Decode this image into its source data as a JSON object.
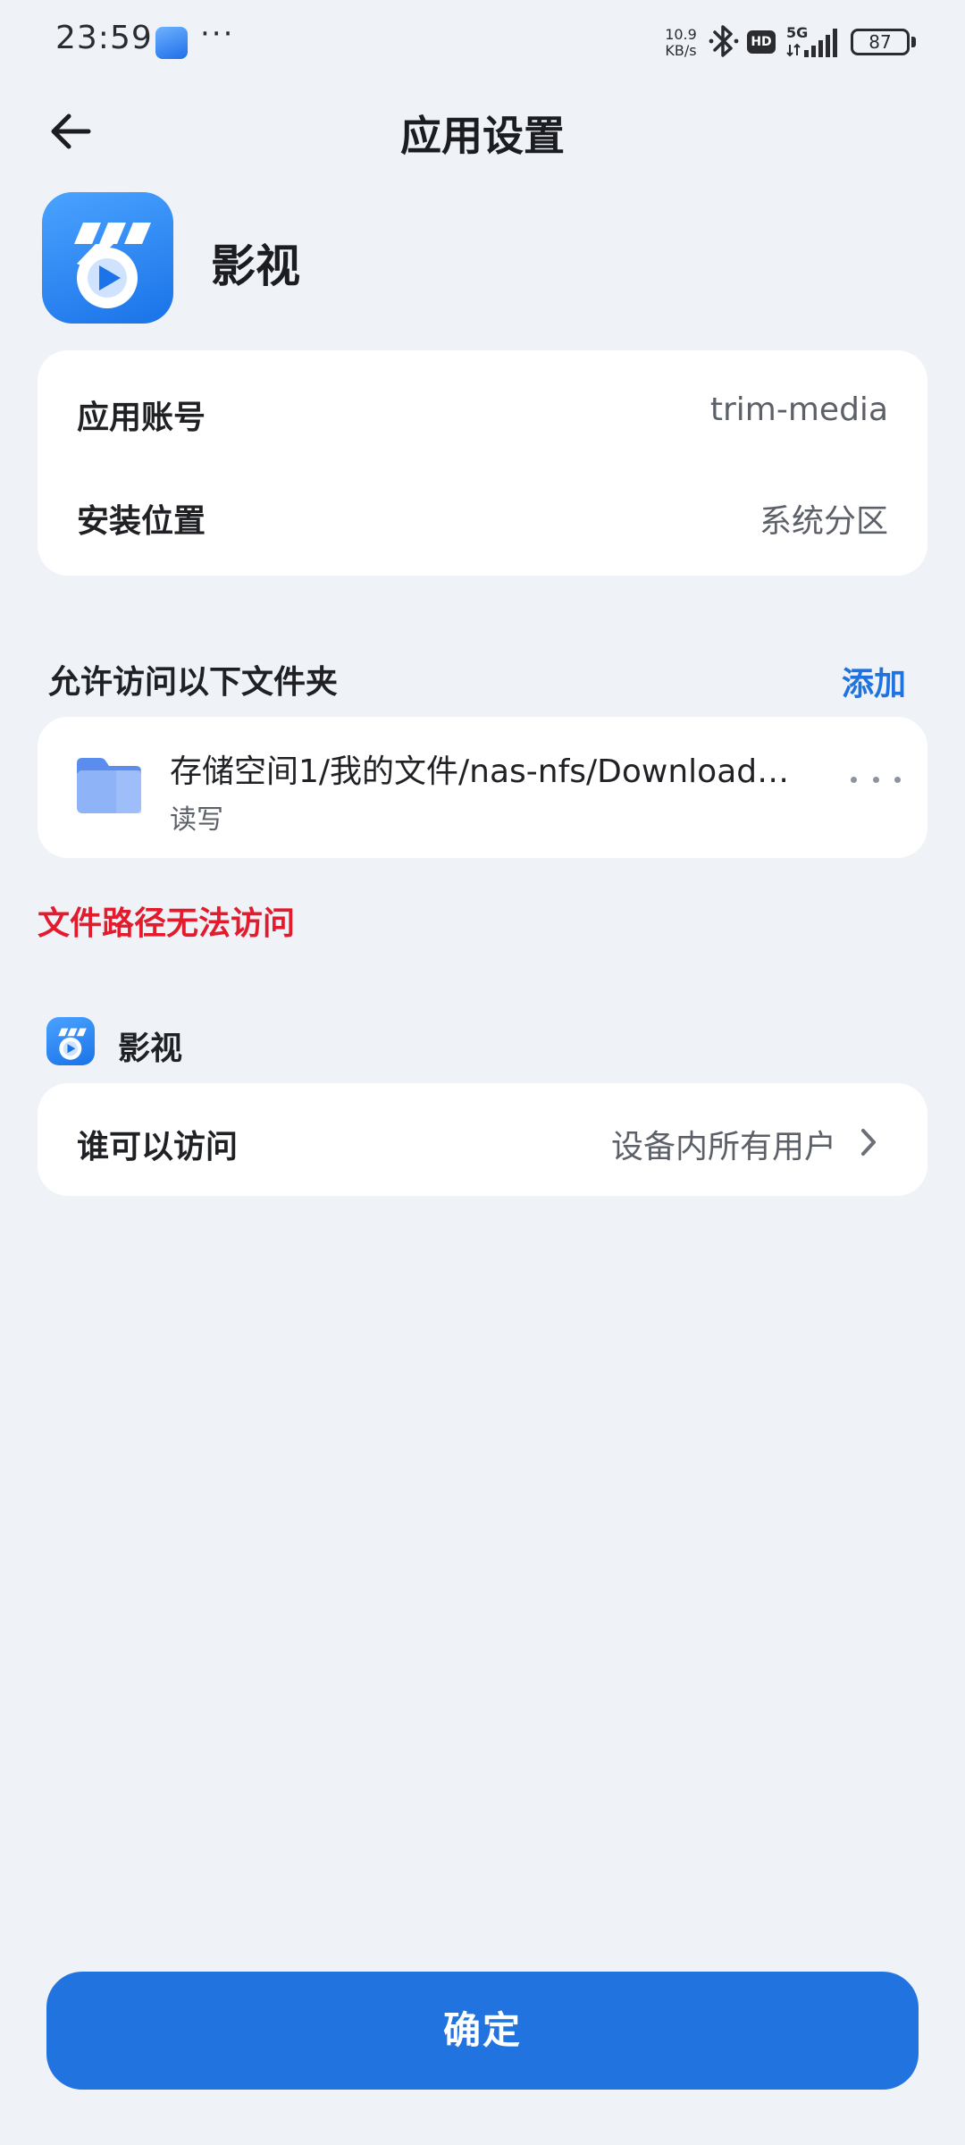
{
  "status_bar": {
    "time": "23:59",
    "overflow_dots": "···",
    "net_speed_value": "10.9",
    "net_speed_unit": "KB/s",
    "hd_badge": "HD",
    "network_type": "5G",
    "battery_level": "87",
    "icons": [
      "weather-icon",
      "bluetooth-icon",
      "hd-icon",
      "signal-5g-icon",
      "battery-icon"
    ]
  },
  "header": {
    "title": "应用设置",
    "back_icon": "arrow-left-icon"
  },
  "app": {
    "name": "影视",
    "icon": "video-app-icon",
    "accent": "#1a73e8"
  },
  "info": {
    "account_label": "应用账号",
    "account_value": "trim-media",
    "install_label": "安装位置",
    "install_value": "系统分区"
  },
  "folders": {
    "section_title": "允许访问以下文件夹",
    "add_label": "添加",
    "items": [
      {
        "path": "存储空间1/我的文件/nas-nfs/Download…",
        "permission": "读写",
        "icon": "folder-icon"
      }
    ],
    "error": "文件路径无法访问"
  },
  "access": {
    "app_name": "影视",
    "label": "谁可以访问",
    "value": "设备内所有用户",
    "chevron": "chevron-right-icon"
  },
  "confirm_label": "确定",
  "colors": {
    "background": "#eff3f8",
    "primary": "#2174e0",
    "error": "#e31b2d"
  }
}
